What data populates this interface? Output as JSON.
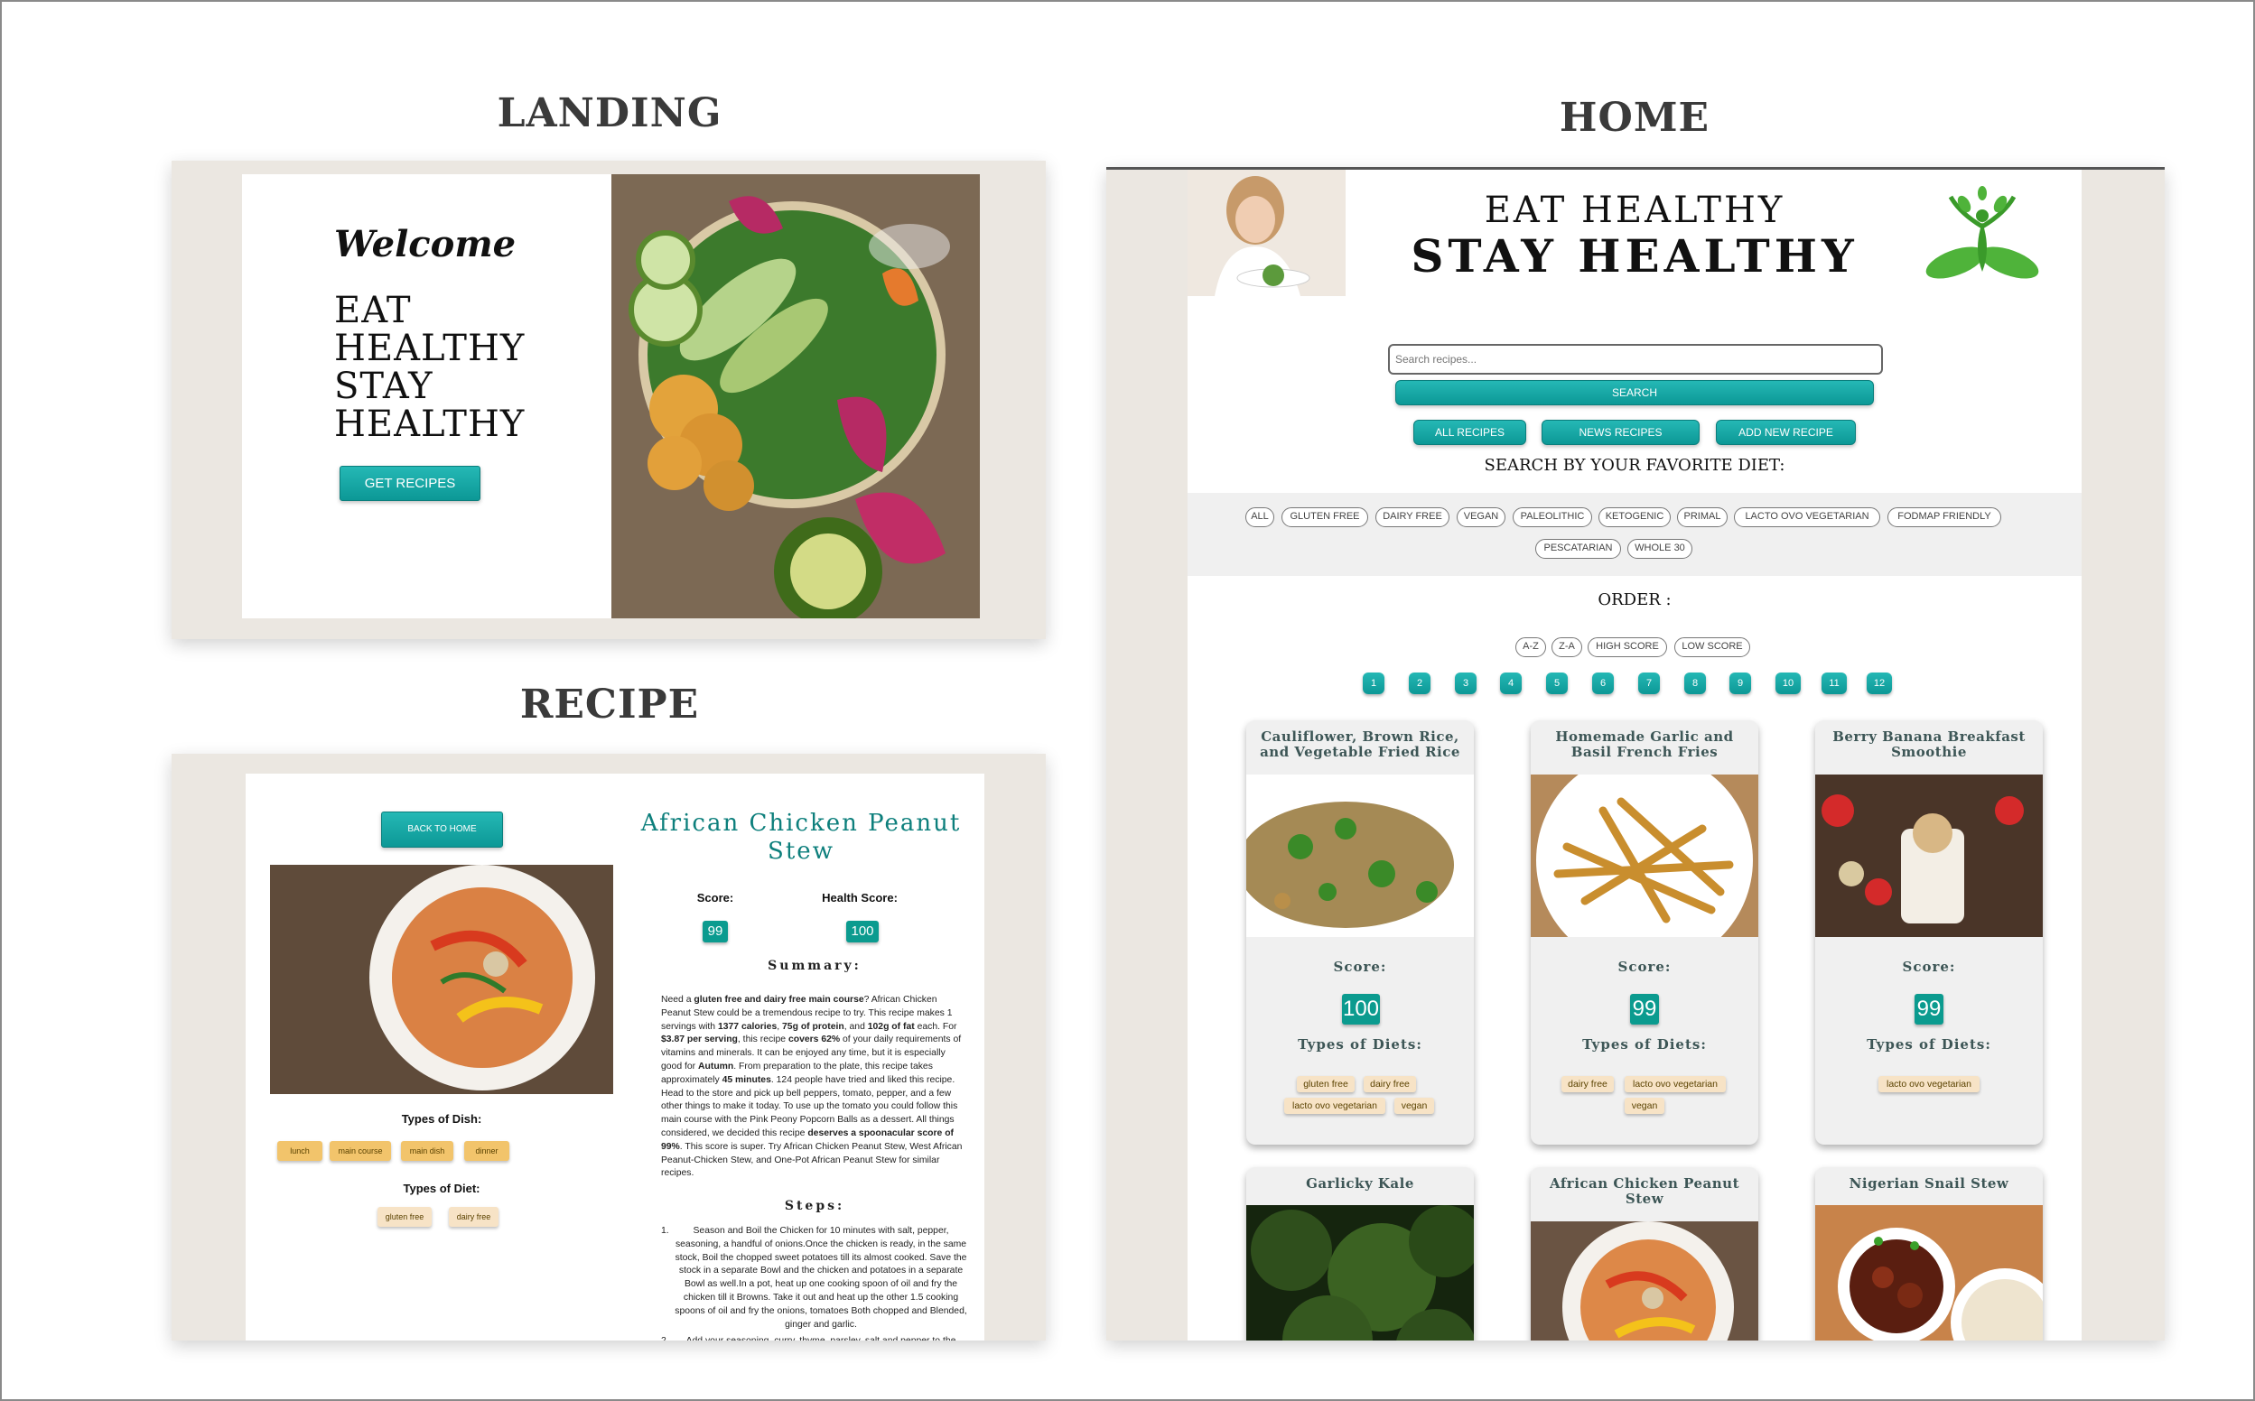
{
  "sections": {
    "landing": "LANDING",
    "home": "HOME",
    "recipe": "RECIPE"
  },
  "landing": {
    "welcome": "Welcome",
    "headline": "EAT\nHEALTHY\nSTAY\nHEALTHY",
    "button": "GET RECIPES"
  },
  "recipe": {
    "back_button": "BACK TO HOME",
    "title": "African Chicken Peanut Stew",
    "score_label": "Score:",
    "score": "99",
    "health_label": "Health Score:",
    "health_score": "100",
    "summary_heading": "Summary:",
    "types_dish_label": "Types of Dish:",
    "dish_tags": [
      "lunch",
      "main course",
      "main dish",
      "dinner"
    ],
    "types_diet_label": "Types of Diet:",
    "diet_tags": [
      "gluten free",
      "dairy free"
    ],
    "summary": [
      {
        "t": "Need a "
      },
      {
        "b": "gluten free and dairy free main course"
      },
      {
        "t": "? African Chicken Peanut Stew could be a tremendous recipe to try. This recipe makes 1 servings with "
      },
      {
        "b": "1377 calories"
      },
      {
        "t": ", "
      },
      {
        "b": "75g of protein"
      },
      {
        "t": ", and "
      },
      {
        "b": "102g of fat"
      },
      {
        "t": " each. For "
      },
      {
        "b": "$3.87 per serving"
      },
      {
        "t": ", this recipe "
      },
      {
        "b": "covers 62%"
      },
      {
        "t": " of your daily requirements of vitamins and minerals. It can be enjoyed any time, but it is especially good for "
      },
      {
        "b": "Autumn"
      },
      {
        "t": ". From preparation to the plate, this recipe takes approximately "
      },
      {
        "b": "45 minutes"
      },
      {
        "t": ". 124 people have tried and liked this recipe. Head to the store and pick up bell peppers, tomato, pepper, and a few other things to make it today. To use up the tomato you could follow this main course with the Pink Peony Popcorn Balls as a dessert. All things considered, we decided this recipe "
      },
      {
        "b": "deserves a spoonacular score of 99%"
      },
      {
        "t": ". This score is super. Try African Chicken Peanut Stew, West African Peanut-Chicken Stew, and One-Pot African Peanut Stew for similar recipes."
      }
    ],
    "steps_heading": "Steps:",
    "steps": [
      {
        "n": "1.",
        "text": "Season and Boil the Chicken for 10 minutes with salt, pepper, seasoning, a handful of onions.Once the chicken is ready, in the same stock, Boil the chopped sweet potatoes till its almost cooked. Save the stock in a separate Bowl and the chicken and potatoes in a separate Bowl as well.In a pot, heat up one cooking spoon of oil and fry the chicken till it Browns. Take it out and heat up the other 1.5 cooking spoons of oil and fry the onions, tomatoes Both chopped and Blended, ginger and garlic."
      },
      {
        "n": "2.",
        "text": "Add your seasoning, curry, thyme, parsley, salt and pepper to the"
      }
    ]
  },
  "home": {
    "headline_1": "EAT HEALTHY",
    "headline_2": "STAY HEALTHY",
    "search_placeholder": "Search recipes...",
    "search_button": "SEARCH",
    "actions": [
      "ALL RECIPES",
      "NEWS RECIPES",
      "ADD NEW RECIPE"
    ],
    "diet_heading": "SEARCH BY YOUR FAVORITE DIET:",
    "diet_filters": [
      "ALL",
      "GLUTEN FREE",
      "DAIRY FREE",
      "VEGAN",
      "PALEOLITHIC",
      "KETOGENIC",
      "PRIMAL",
      "LACTO OVO VEGETARIAN",
      "FODMAP FRIENDLY",
      "PESCATARIAN",
      "WHOLE 30"
    ],
    "order_heading": "ORDER :",
    "order_options": [
      "A-Z",
      "Z-A",
      "HIGH SCORE",
      "LOW SCORE"
    ],
    "pages": [
      "1",
      "2",
      "3",
      "4",
      "5",
      "6",
      "7",
      "8",
      "9",
      "10",
      "11",
      "12"
    ],
    "score_label": "Score:",
    "types_label": "Types of Diets:",
    "cards": [
      {
        "title": "Cauliflower, Brown Rice, and Vegetable Fried Rice",
        "score": "100",
        "diets": [
          "gluten free",
          "dairy free",
          "lacto ovo vegetarian",
          "vegan"
        ]
      },
      {
        "title": "Homemade Garlic and Basil French Fries",
        "score": "99",
        "diets": [
          "dairy free",
          "lacto ovo vegetarian",
          "vegan"
        ]
      },
      {
        "title": "Berry Banana Breakfast Smoothie",
        "score": "99",
        "diets": [
          "lacto ovo vegetarian"
        ]
      },
      {
        "title": "Garlicky Kale"
      },
      {
        "title": "African Chicken Peanut Stew"
      },
      {
        "title": "Nigerian Snail Stew"
      }
    ]
  }
}
